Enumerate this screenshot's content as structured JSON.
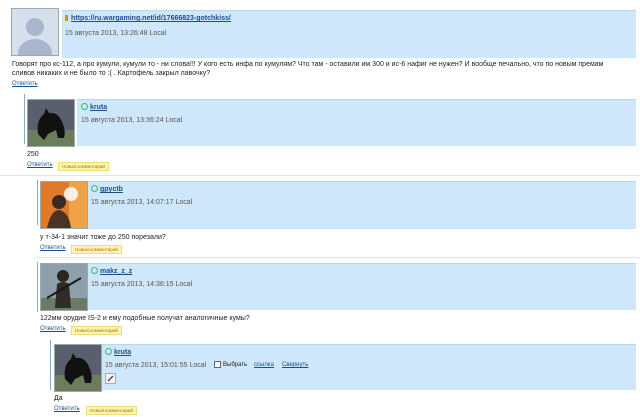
{
  "comments": [
    {
      "user_link": "https://ru.wargaming.net/id/17666823-gotchkiss/",
      "date": "15 августа 2013, 13:26:48 Local",
      "text": "Говорят про кс-112, а про кумули, кумули то - ни слова!!! У кого есть инфа по кумулям? Что там - оставили им 300 и ис-6 нафиг не нужен? И вообще печально, что по новым премам сливов никаких и не было то :( . Картофель закрыл лавочку?",
      "reply_label": "Ответить"
    },
    {
      "user": "kruta",
      "date": "15 августа 2013, 13:36:24 Local",
      "text": "250",
      "reply_label": "Ответить",
      "badge": "Новый комментарий"
    },
    {
      "user": "gpyctb",
      "date": "15 августа 2013, 14:07:17 Local",
      "text": "у т-34-1 значит тоже до 250 порезали?",
      "reply_label": "Ответить",
      "badge": "Новый комментарий"
    },
    {
      "user": "makz_z_z",
      "date": "15 августа 2013, 14:36:15 Local",
      "text": "122мм орудие IS-2 и ему подобные получат аналогичные кумы?",
      "reply_label": "Ответить",
      "badge": "Новый комментарий"
    },
    {
      "user": "kruta",
      "date": "15 августа 2013, 15:01:55 Local",
      "text": "Да",
      "reply_label": "Ответить",
      "badge": "Новый комментарий",
      "select_label": "Выбрать",
      "link_label": "ссылка",
      "collapse_label": "Свернуть"
    }
  ],
  "colors": {
    "header_bar": "#cfe7fa",
    "link": "#1a4f8b",
    "badge_bg": "#fff3b0"
  }
}
